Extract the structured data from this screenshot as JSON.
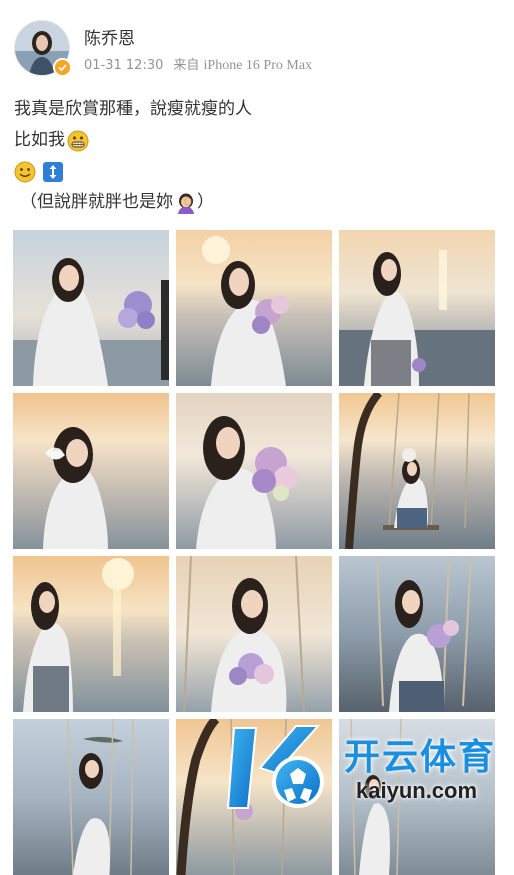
{
  "post": {
    "user_name": "陈乔恩",
    "timestamp": "01-31 12:30",
    "source_prefix": "来自",
    "device": "iPhone 16 Pro Max",
    "line1": "我真是欣賞那種，說瘦就瘦的人",
    "line2": "比如我",
    "line4": "（但說胖就胖也是妳",
    "line4_end": "）"
  },
  "emojis": {
    "line2": "grinning-teeth-emoji",
    "line3a": "smiley-emoji",
    "line3b": "up-down-arrow-emoji",
    "line4": "facepalm-woman-emoji"
  },
  "colors": {
    "text": "#333333",
    "meta": "#939393",
    "watermark_blue": "#1a8fe0"
  },
  "watermark": {
    "title": "开云体育",
    "url": "kaiyun.com"
  }
}
